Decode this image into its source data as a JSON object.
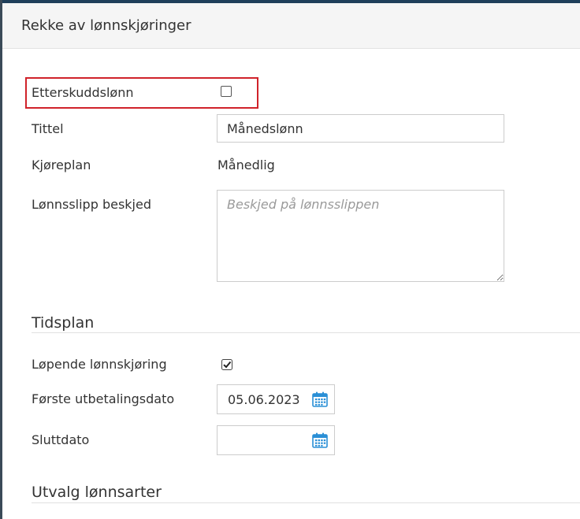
{
  "dialog": {
    "title": "Rekke av lønnskjøringer"
  },
  "fields": {
    "etterskudd": {
      "label": "Etterskuddslønn",
      "checked": false
    },
    "tittel": {
      "label": "Tittel",
      "value": "Månedslønn"
    },
    "kjoreplan": {
      "label": "Kjøreplan",
      "value": "Månedlig"
    },
    "lonnsslipp": {
      "label": "Lønnsslipp beskjed",
      "value": "",
      "placeholder": "Beskjed på lønnsslippen"
    }
  },
  "tidsplan": {
    "heading": "Tidsplan",
    "lopende": {
      "label": "Løpende lønnskjøring",
      "checked": true
    },
    "forste_dato": {
      "label": "Første utbetalingsdato",
      "value": "05.06.2023"
    },
    "sluttdato": {
      "label": "Sluttdato",
      "value": ""
    }
  },
  "utvalg": {
    "heading": "Utvalg lønnsarter"
  },
  "colors": {
    "highlight": "#d0222a",
    "calendar_icon": "#2a8fd6",
    "header_bg": "#f5f5f5"
  },
  "icons": {
    "calendar": "calendar-icon",
    "checkmark": "checkmark-icon"
  }
}
